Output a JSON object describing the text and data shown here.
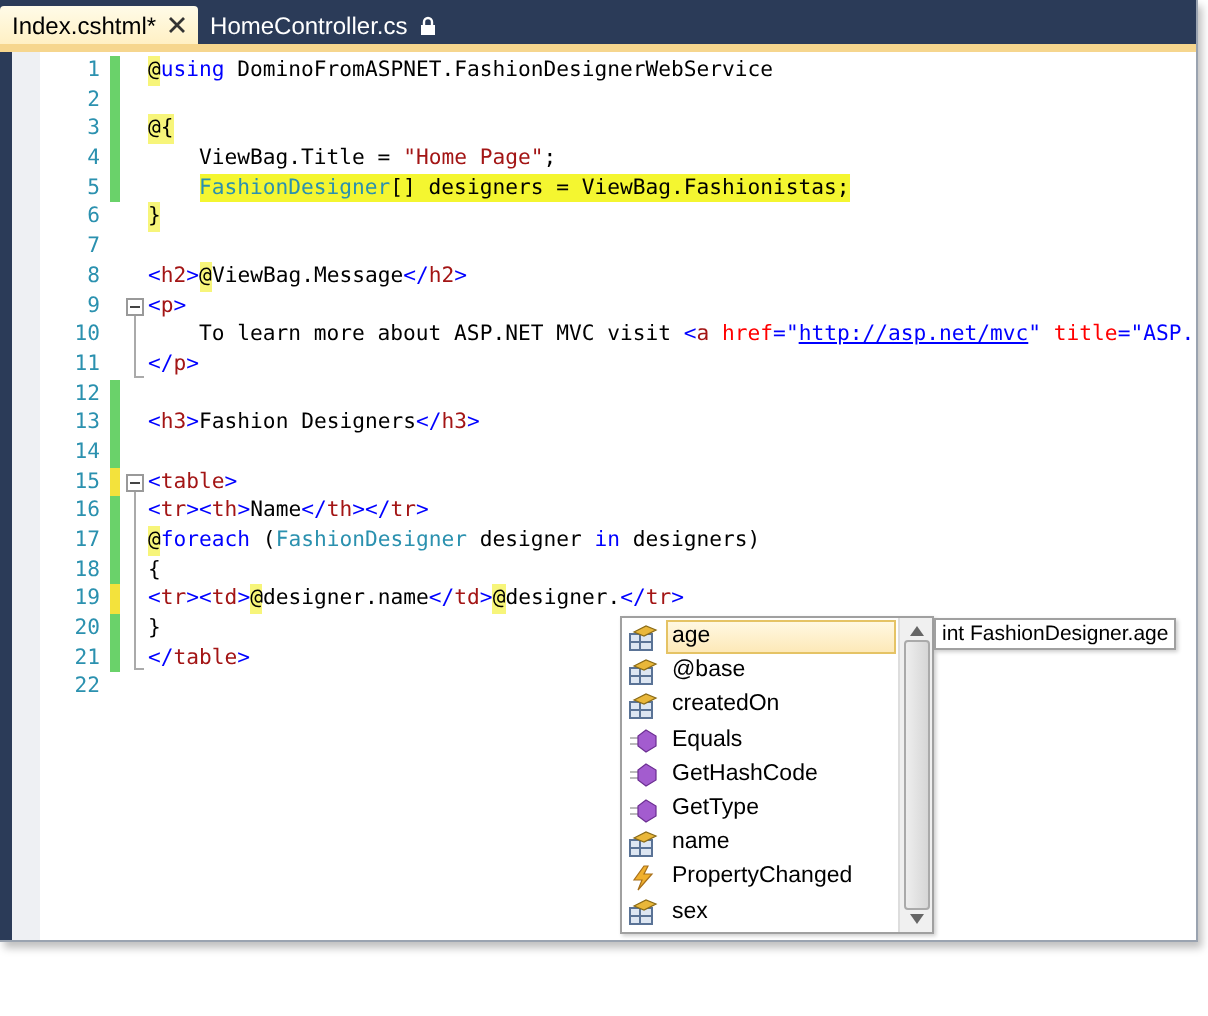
{
  "tabs": [
    {
      "label": "Index.cshtml*",
      "selected": true,
      "kind": "closable"
    },
    {
      "label": "HomeController.cs",
      "selected": false,
      "kind": "locked"
    }
  ],
  "editor": {
    "lines": [
      {
        "number": "1",
        "changed": true,
        "unsaved": false,
        "collapsible": false,
        "in_fold": false,
        "indented": false,
        "highlighted": false,
        "tokens": [
          {
            "kind": "razor",
            "text": "@"
          },
          {
            "kind": "keyword",
            "text": "using"
          },
          {
            "kind": "plain",
            "text": " DominoFromASPNET.FashionDesignerWebService"
          }
        ]
      },
      {
        "number": "2",
        "changed": true,
        "unsaved": false,
        "collapsible": false,
        "in_fold": false,
        "indented": false,
        "highlighted": false
      },
      {
        "number": "3",
        "changed": true,
        "unsaved": false,
        "collapsible": false,
        "in_fold": false,
        "indented": false,
        "highlighted": false,
        "tokens": [
          {
            "kind": "razor",
            "text": "@{"
          }
        ]
      },
      {
        "number": "4",
        "changed": true,
        "unsaved": false,
        "collapsible": false,
        "in_fold": false,
        "indented": true,
        "highlighted": false,
        "tokens": [
          {
            "kind": "plain",
            "text": "ViewBag.Title = "
          },
          {
            "kind": "string",
            "text": "\"Home Page\""
          },
          {
            "kind": "plain",
            "text": ";"
          }
        ]
      },
      {
        "number": "5",
        "changed": true,
        "unsaved": false,
        "collapsible": false,
        "in_fold": false,
        "indented": true,
        "highlighted": true,
        "tokens": [
          {
            "kind": "type",
            "text": "FashionDesigner"
          },
          {
            "kind": "plain",
            "text": "[] designers = ViewBag.Fashionistas;"
          }
        ]
      },
      {
        "number": "6",
        "changed": false,
        "unsaved": false,
        "collapsible": false,
        "in_fold": false,
        "indented": false,
        "highlighted": false,
        "tokens": [
          {
            "kind": "razor",
            "text": "}"
          }
        ]
      },
      {
        "number": "7",
        "changed": false,
        "unsaved": false,
        "collapsible": false,
        "in_fold": false,
        "indented": false,
        "highlighted": false
      },
      {
        "number": "8",
        "changed": false,
        "unsaved": false,
        "collapsible": false,
        "in_fold": false,
        "indented": false,
        "highlighted": false,
        "tokens": [
          {
            "kind": "tag",
            "text": "<"
          },
          {
            "kind": "tagname",
            "text": "h2"
          },
          {
            "kind": "tag",
            "text": ">"
          },
          {
            "kind": "razor",
            "text": "@"
          },
          {
            "kind": "plain",
            "text": "ViewBag.Message"
          },
          {
            "kind": "tag",
            "text": "</"
          },
          {
            "kind": "tagname",
            "text": "h2"
          },
          {
            "kind": "tag",
            "text": ">"
          }
        ]
      },
      {
        "number": "9",
        "changed": false,
        "unsaved": false,
        "collapsible": true,
        "in_fold": false,
        "indented": false,
        "highlighted": false,
        "tokens": [
          {
            "kind": "tag",
            "text": "<"
          },
          {
            "kind": "tagname",
            "text": "p"
          },
          {
            "kind": "tag",
            "text": ">"
          }
        ]
      },
      {
        "number": "10",
        "changed": false,
        "unsaved": false,
        "collapsible": false,
        "in_fold": true,
        "indented": true,
        "highlighted": false,
        "tokens": [
          {
            "kind": "plain",
            "text": "To learn more about ASP.NET MVC visit "
          },
          {
            "kind": "tag",
            "text": "<"
          },
          {
            "kind": "tagname",
            "text": "a"
          },
          {
            "kind": "attr",
            "text": " href"
          },
          {
            "kind": "tag",
            "text": "="
          },
          {
            "kind": "value",
            "text": "\""
          },
          {
            "kind": "link",
            "text": "http://asp.net/mvc"
          },
          {
            "kind": "value",
            "text": "\""
          },
          {
            "kind": "attr",
            "text": " title"
          },
          {
            "kind": "tag",
            "text": "="
          },
          {
            "kind": "value",
            "text": "\"ASP."
          }
        ]
      },
      {
        "number": "11",
        "changed": false,
        "unsaved": false,
        "collapsible": false,
        "in_fold": true,
        "indented": false,
        "highlighted": false,
        "tokens": [
          {
            "kind": "tag",
            "text": "</"
          },
          {
            "kind": "tagname",
            "text": "p"
          },
          {
            "kind": "tag",
            "text": ">"
          }
        ]
      },
      {
        "number": "12",
        "changed": true,
        "unsaved": false,
        "collapsible": false,
        "in_fold": false,
        "indented": false,
        "highlighted": false
      },
      {
        "number": "13",
        "changed": true,
        "unsaved": false,
        "collapsible": false,
        "in_fold": false,
        "indented": false,
        "highlighted": false,
        "tokens": [
          {
            "kind": "tag",
            "text": "<"
          },
          {
            "kind": "tagname",
            "text": "h3"
          },
          {
            "kind": "tag",
            "text": ">"
          },
          {
            "kind": "plain",
            "text": "Fashion Designers"
          },
          {
            "kind": "tag",
            "text": "</"
          },
          {
            "kind": "tagname",
            "text": "h3"
          },
          {
            "kind": "tag",
            "text": ">"
          }
        ]
      },
      {
        "number": "14",
        "changed": true,
        "unsaved": false,
        "collapsible": false,
        "in_fold": false,
        "indented": false,
        "highlighted": false
      },
      {
        "number": "15",
        "changed": true,
        "unsaved": true,
        "collapsible": true,
        "in_fold": false,
        "indented": false,
        "highlighted": false,
        "tokens": [
          {
            "kind": "tag",
            "text": "<"
          },
          {
            "kind": "tagname",
            "text": "table"
          },
          {
            "kind": "tag",
            "text": ">"
          }
        ]
      },
      {
        "number": "16",
        "changed": true,
        "unsaved": false,
        "collapsible": false,
        "in_fold": true,
        "indented": false,
        "highlighted": false,
        "tokens": [
          {
            "kind": "tag",
            "text": "<"
          },
          {
            "kind": "tagname",
            "text": "tr"
          },
          {
            "kind": "tag",
            "text": "><"
          },
          {
            "kind": "tagname",
            "text": "th"
          },
          {
            "kind": "tag",
            "text": ">"
          },
          {
            "kind": "plain",
            "text": "Name"
          },
          {
            "kind": "tag",
            "text": "</"
          },
          {
            "kind": "tagname",
            "text": "th"
          },
          {
            "kind": "tag",
            "text": "></"
          },
          {
            "kind": "tagname",
            "text": "tr"
          },
          {
            "kind": "tag",
            "text": ">"
          }
        ]
      },
      {
        "number": "17",
        "changed": true,
        "unsaved": false,
        "collapsible": false,
        "in_fold": true,
        "indented": false,
        "highlighted": false,
        "tokens": [
          {
            "kind": "razor",
            "text": "@"
          },
          {
            "kind": "keyword",
            "text": "foreach"
          },
          {
            "kind": "plain",
            "text": " ("
          },
          {
            "kind": "type",
            "text": "FashionDesigner"
          },
          {
            "kind": "plain",
            "text": " designer "
          },
          {
            "kind": "keyword",
            "text": "in"
          },
          {
            "kind": "plain",
            "text": " designers)"
          }
        ]
      },
      {
        "number": "18",
        "changed": true,
        "unsaved": false,
        "collapsible": false,
        "in_fold": true,
        "indented": false,
        "highlighted": false,
        "tokens": [
          {
            "kind": "plain",
            "text": "{"
          }
        ]
      },
      {
        "number": "19",
        "changed": true,
        "unsaved": true,
        "collapsible": false,
        "in_fold": true,
        "indented": false,
        "highlighted": false,
        "tokens": [
          {
            "kind": "tag",
            "text": "<"
          },
          {
            "kind": "tagname",
            "text": "tr"
          },
          {
            "kind": "tag",
            "text": "><"
          },
          {
            "kind": "tagname",
            "text": "td"
          },
          {
            "kind": "tag",
            "text": ">"
          },
          {
            "kind": "razor",
            "text": "@"
          },
          {
            "kind": "plain",
            "text": "designer.name"
          },
          {
            "kind": "tag",
            "text": "</"
          },
          {
            "kind": "tagname",
            "text": "td"
          },
          {
            "kind": "tag",
            "text": ">"
          },
          {
            "kind": "razor",
            "text": "@"
          },
          {
            "kind": "plain",
            "text": "designer."
          },
          {
            "kind": "tag",
            "text": "</"
          },
          {
            "kind": "tagname",
            "text": "tr"
          },
          {
            "kind": "tag",
            "text": ">"
          }
        ]
      },
      {
        "number": "20",
        "changed": true,
        "unsaved": false,
        "collapsible": false,
        "in_fold": true,
        "indented": false,
        "highlighted": false,
        "tokens": [
          {
            "kind": "plain",
            "text": "}"
          }
        ]
      },
      {
        "number": "21",
        "changed": true,
        "unsaved": false,
        "collapsible": false,
        "in_fold": true,
        "indented": false,
        "highlighted": false,
        "tokens": [
          {
            "kind": "tag",
            "text": "</"
          },
          {
            "kind": "tagname",
            "text": "table"
          },
          {
            "kind": "tag",
            "text": ">"
          }
        ]
      },
      {
        "number": "22",
        "changed": false,
        "unsaved": false,
        "collapsible": false,
        "in_fold": false,
        "indented": false,
        "highlighted": false
      }
    ]
  },
  "completion": {
    "items": [
      {
        "label": "age",
        "kind": "property",
        "selected": true
      },
      {
        "label": "@base",
        "kind": "property",
        "selected": false
      },
      {
        "label": "createdOn",
        "kind": "property",
        "selected": false
      },
      {
        "label": "Equals",
        "kind": "method",
        "selected": false
      },
      {
        "label": "GetHashCode",
        "kind": "method",
        "selected": false
      },
      {
        "label": "GetType",
        "kind": "method",
        "selected": false
      },
      {
        "label": "name",
        "kind": "property",
        "selected": false
      },
      {
        "label": "PropertyChanged",
        "kind": "event",
        "selected": false
      },
      {
        "label": "sex",
        "kind": "property",
        "selected": false
      }
    ],
    "tooltip": "int FashionDesigner.age"
  }
}
